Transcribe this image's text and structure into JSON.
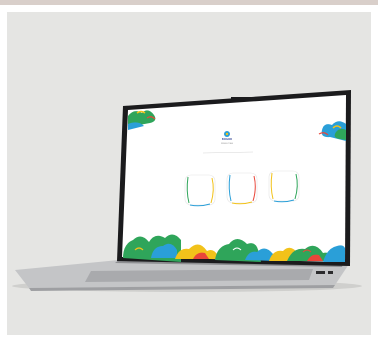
{
  "screen": {
    "brand": {
      "line1": "BOGOR",
      "line2": "PENELITIAN",
      "line3": ""
    },
    "cards": [
      {
        "label": ""
      },
      {
        "label": ""
      },
      {
        "label": ""
      }
    ]
  },
  "colors": {
    "background": "#e5e5e3",
    "laptop_body": "#b9babc",
    "bezel": "#1b1b1d",
    "screen": "#ffffff",
    "cloud_green": "#2fa55a",
    "cloud_blue": "#2a9fd8",
    "cloud_yellow": "#f2c21a",
    "cloud_red": "#e9463a"
  },
  "icons": [
    "laptop-icon",
    "cloud-ornament-icon"
  ]
}
